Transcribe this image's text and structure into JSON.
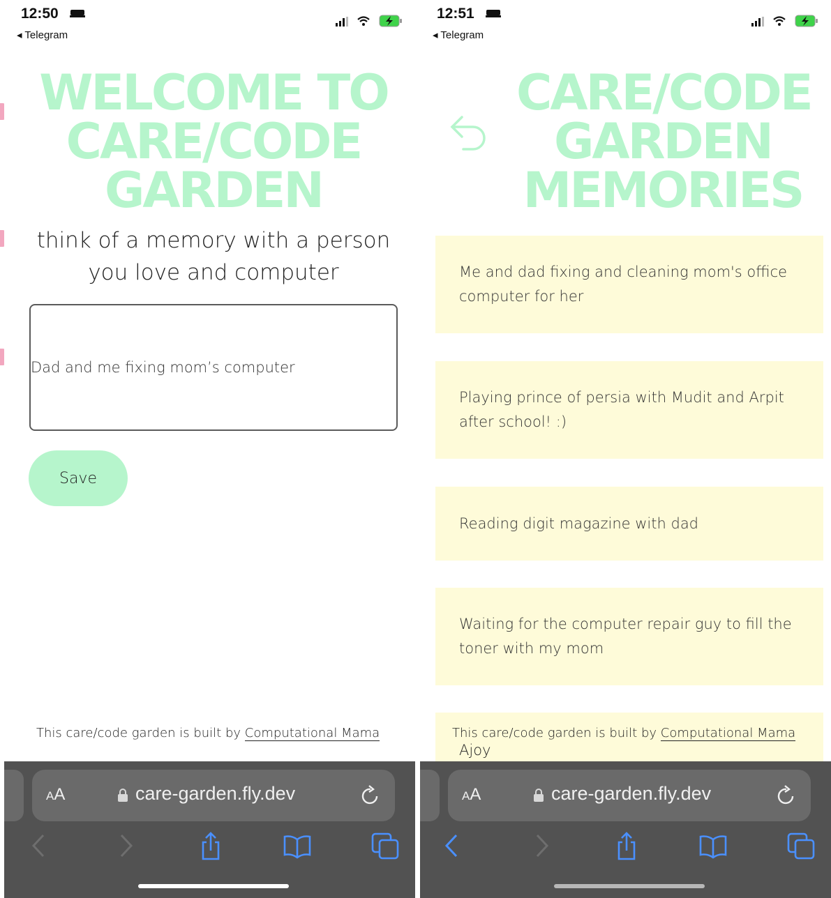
{
  "left_screen": {
    "status_time": "12:50",
    "back_app": "◂ Telegram",
    "title_lines": [
      "WELCOME TO",
      "CARE/CODE",
      "GARDEN"
    ],
    "prompt_lines": [
      "think of a memory with a person",
      "you love and computer"
    ],
    "memory_input_value": "Dad and me fixing mom’s computer",
    "save_label": "Save",
    "footer_text": "This care/code garden is built by ",
    "footer_link": "Computational Mama",
    "url": "care-garden.fly.dev"
  },
  "right_screen": {
    "status_time": "12:51",
    "back_app": "◂ Telegram",
    "title_lines": [
      "CARE/CODE",
      "GARDEN",
      "MEMORIES"
    ],
    "memories": [
      "Me and dad fixing and cleaning mom's office computer for her",
      "Playing prince of persia with Mudit and Arpit after school! :)",
      "Reading digit magazine with dad",
      "Waiting for the computer repair guy to fill the toner with my mom"
    ],
    "footer_text": "This care/code garden is built by ",
    "footer_link": "Computational Mama",
    "footer_continuation": "Ajoy",
    "url": "care-garden.fly.dev"
  },
  "browser": {
    "aa_small": "A",
    "aa_large": "A"
  },
  "colors": {
    "mint": "#b6f5cc",
    "card_yellow": "#fefbd9",
    "toolbar": "#525252",
    "link_blue": "#4a90ff"
  }
}
